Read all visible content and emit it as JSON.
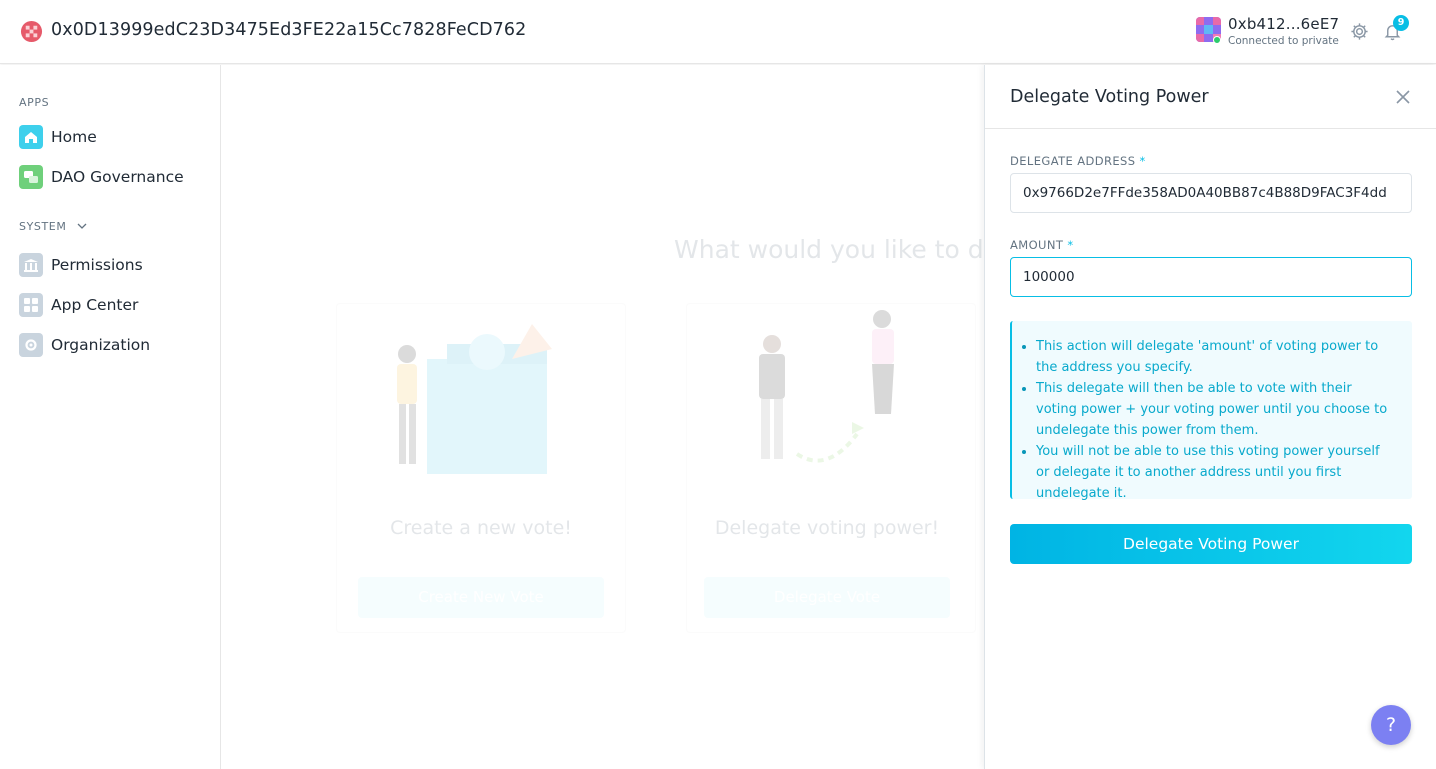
{
  "header": {
    "org_address": "0x0D13999edC23D3475Ed3FE22a15Cc7828FeCD762",
    "account_name": "0xb412...6eE7",
    "account_status": "Connected to private",
    "notification_count": "9"
  },
  "sidebar": {
    "apps_label": "APPS",
    "system_label": "SYSTEM",
    "apps": [
      {
        "label": "Home",
        "icon": "home-icon"
      },
      {
        "label": "DAO Governance",
        "icon": "governance-icon"
      }
    ],
    "system": [
      {
        "label": "Permissions",
        "icon": "permissions-icon"
      },
      {
        "label": "App Center",
        "icon": "app-center-icon"
      },
      {
        "label": "Organization",
        "icon": "organization-icon"
      }
    ]
  },
  "main": {
    "title": "What would you like to do?",
    "cards": [
      {
        "title": "Create a new vote!",
        "button": "Create New Vote"
      },
      {
        "title": "Delegate voting power!",
        "button": "Delegate Vote"
      }
    ]
  },
  "panel": {
    "title": "Delegate Voting Power",
    "delegate_address_label": "DELEGATE ADDRESS",
    "delegate_address_value": "0x9766D2e7FFde358AD0A40BB87c4B88D9FAC3F4dd",
    "amount_label": "AMOUNT",
    "amount_value": "100000",
    "required_mark": "*",
    "info_items": [
      "This action will delegate 'amount' of voting power to the address you specify.",
      "This delegate will then be able to vote with their voting power + your voting power until you choose to undelegate this power from them.",
      "You will not be able to use this voting power yourself or delegate it to another address until you first undelegate it."
    ],
    "submit_label": "Delegate Voting Power"
  },
  "help_label": "?",
  "colors": {
    "accent": "#08bee5",
    "help": "#7c80f2",
    "text": "#212b36",
    "muted": "#637381"
  }
}
